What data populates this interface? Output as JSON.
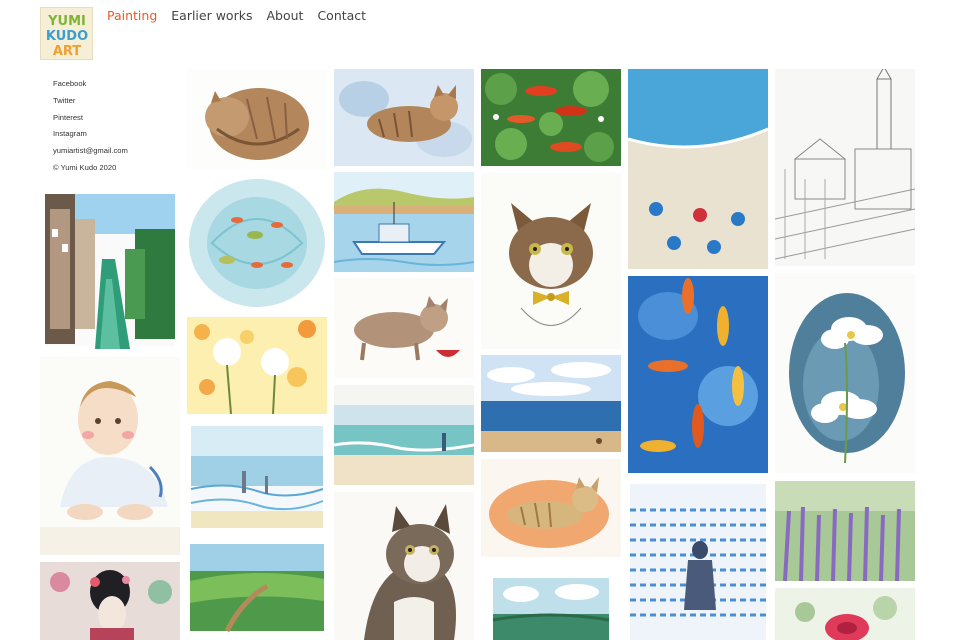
{
  "logo": {
    "line1": "YUMI",
    "line2": "KUDO",
    "line3": "ART"
  },
  "nav": {
    "items": [
      {
        "label": "Painting",
        "active": true
      },
      {
        "label": "Earlier works",
        "active": false
      },
      {
        "label": "About",
        "active": false
      },
      {
        "label": "Contact",
        "active": false
      }
    ]
  },
  "sidebar": {
    "links": [
      {
        "label": "Facebook"
      },
      {
        "label": "Twitter"
      },
      {
        "label": "Pinterest"
      },
      {
        "label": "Instagram"
      },
      {
        "label": "yumiartist@gmail.com"
      },
      {
        "label": "© Yumi Kudo 2020"
      }
    ]
  },
  "gallery": {
    "artworks": [
      {
        "name": "canal-town",
        "icon": "canal-painting-icon"
      },
      {
        "name": "baby-portrait",
        "icon": "baby-painting-icon"
      },
      {
        "name": "geisha",
        "icon": "geisha-painting-icon"
      },
      {
        "name": "sleeping-cat",
        "icon": "cat-painting-icon"
      },
      {
        "name": "leaves-pond",
        "icon": "pond-painting-icon"
      },
      {
        "name": "dandelions",
        "icon": "flower-painting-icon"
      },
      {
        "name": "beach-walkers",
        "icon": "beach-painting-icon"
      },
      {
        "name": "green-coast",
        "icon": "landscape-painting-icon"
      },
      {
        "name": "lounging-cat",
        "icon": "cat-painting-icon"
      },
      {
        "name": "harbor-boat",
        "icon": "boat-painting-icon"
      },
      {
        "name": "cat-and-bowl",
        "icon": "cat-painting-icon"
      },
      {
        "name": "sea-shore",
        "icon": "sea-painting-icon"
      },
      {
        "name": "tabby-portrait",
        "icon": "cat-painting-icon"
      },
      {
        "name": "koi-lily-pads",
        "icon": "koi-painting-icon"
      },
      {
        "name": "bowtie-cat",
        "icon": "cat-painting-icon"
      },
      {
        "name": "sky-sea",
        "icon": "sea-painting-icon"
      },
      {
        "name": "ginger-cat",
        "icon": "cat-painting-icon"
      },
      {
        "name": "clouds-field",
        "icon": "landscape-painting-icon"
      },
      {
        "name": "umbrella-beach",
        "icon": "beach-painting-icon"
      },
      {
        "name": "koi-blue",
        "icon": "koi-painting-icon"
      },
      {
        "name": "wading-figure",
        "icon": "sea-painting-icon"
      },
      {
        "name": "town-sketch",
        "icon": "sketch-icon"
      },
      {
        "name": "white-cosmos",
        "icon": "flower-painting-icon"
      },
      {
        "name": "lavender-field",
        "icon": "flower-painting-icon"
      },
      {
        "name": "red-flower",
        "icon": "flower-painting-icon"
      }
    ]
  },
  "colors": {
    "accent": "#e85a24",
    "text": "#333333",
    "background": "#ffffff"
  }
}
